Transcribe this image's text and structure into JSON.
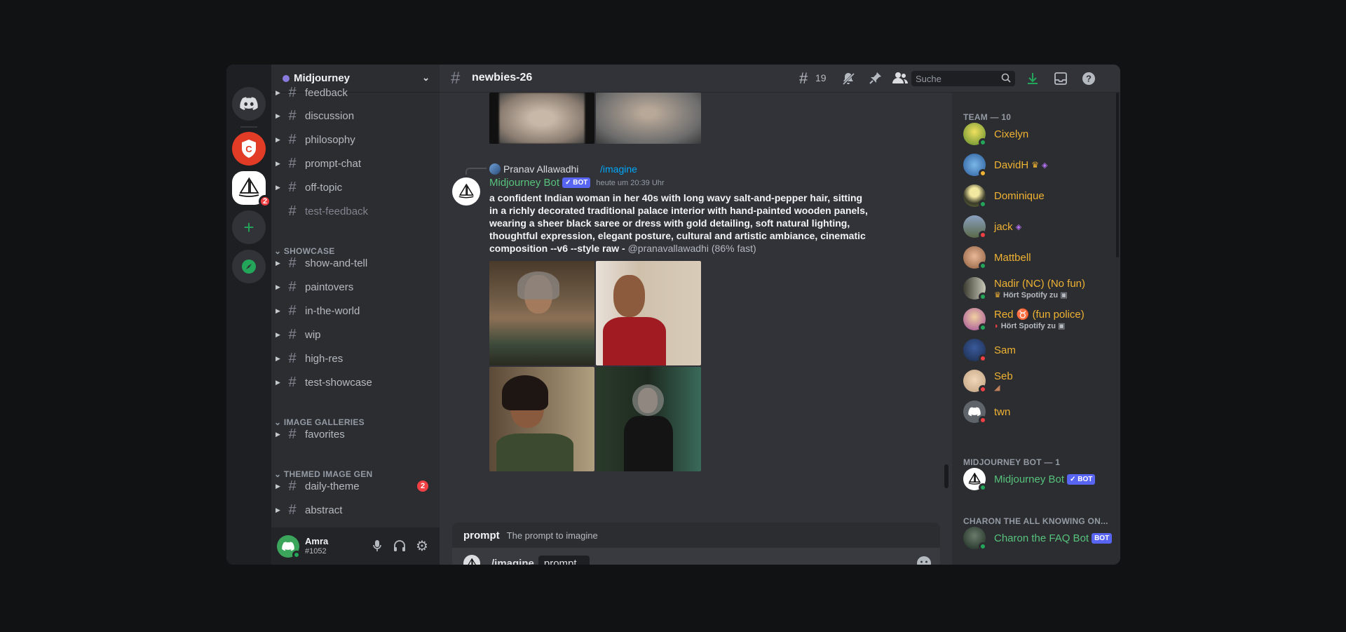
{
  "app": {
    "server_name": "Midjourney",
    "channel": "newbies-26"
  },
  "header": {
    "threads_count": "19",
    "search_placeholder": "Suche"
  },
  "server_rail": {
    "midjourney_badge": "2"
  },
  "channels": [
    {
      "name": "feedback",
      "type": "forum"
    },
    {
      "name": "discussion",
      "type": "forum"
    },
    {
      "name": "philosophy",
      "type": "text"
    },
    {
      "name": "prompt-chat",
      "type": "forum"
    },
    {
      "name": "off-topic",
      "type": "text"
    },
    {
      "name": "test-feedback",
      "type": "text",
      "muted": true
    }
  ],
  "categories": {
    "showcase": "SHOWCASE",
    "galleries": "IMAGE GALLERIES",
    "themed": "THEMED IMAGE GEN"
  },
  "showcase_channels": [
    "show-and-tell",
    "paintovers",
    "in-the-world",
    "wip",
    "high-res",
    "test-showcase"
  ],
  "gallery_channels": [
    "favorites"
  ],
  "themed_channels": [
    {
      "name": "daily-theme",
      "badge": "2"
    },
    {
      "name": "abstract"
    }
  ],
  "user": {
    "name": "Amra",
    "tag": "#1052"
  },
  "message": {
    "reply_user": "Pranav Allawadhi",
    "reply_command": "/imagine",
    "author": "Midjourney Bot",
    "bot_tag": "BOT",
    "timestamp": "heute um 20:39 Uhr",
    "text_line1": "a confident Indian woman in her 40s with long wavy salt-and-pepper hair, sitting",
    "text_line2": "in a richly decorated traditional palace interior with hand-painted wooden panels,",
    "text_line3": "wearing a sheer black saree or dress with gold detailing, soft natural lighting,",
    "text_line4": "thoughtful expression, elegant posture, cultural and artistic ambiance, cinematic",
    "text_line5_bold": "composition --v6 --style raw - ",
    "mention": "@pranavallawadhi",
    "speed": " (86% fast)"
  },
  "autocomplete": {
    "option": "prompt",
    "description": "The prompt to imagine"
  },
  "composer": {
    "command": "/imagine",
    "param": "prompt"
  },
  "members": {
    "team_header": "TEAM — 10",
    "team": [
      {
        "name": "Cixelyn",
        "status": "online",
        "color": "#f0b232"
      },
      {
        "name": "DavidH",
        "status": "idle",
        "color": "#f0b232"
      },
      {
        "name": "Dominique",
        "status": "online",
        "color": "#f0b232"
      },
      {
        "name": "jack",
        "status": "dnd",
        "color": "#f0b232"
      },
      {
        "name": "Mattbell",
        "status": "online",
        "color": "#f0b232"
      },
      {
        "name": "Nadir (NC) (No fun)",
        "status": "online",
        "activity": "Hört Spotify zu",
        "color": "#f0b232"
      },
      {
        "name": "Red",
        "name_suffix": "(fun police)",
        "status": "online",
        "activity": "Hört Spotify zu",
        "color": "#f0b232"
      },
      {
        "name": "Sam",
        "status": "dnd",
        "color": "#f0b232"
      },
      {
        "name": "Seb",
        "status": "dnd",
        "color": "#f0b232"
      },
      {
        "name": "twn",
        "status": "dnd",
        "color": "#f0b232"
      }
    ],
    "bot_header": "MIDJOURNEY BOT — 1",
    "bot_name": "Midjourney Bot",
    "charon_header": "CHARON THE ALL KNOWING ON...",
    "charon_name": "Charon the FAQ Bot",
    "bot_tag": "BOT"
  },
  "colors": {
    "accent": "#5865f2",
    "online": "#23a55a",
    "idle": "#f0b232",
    "dnd": "#f23f43",
    "bot_name": "#57c27c",
    "download": "#23a55a"
  }
}
